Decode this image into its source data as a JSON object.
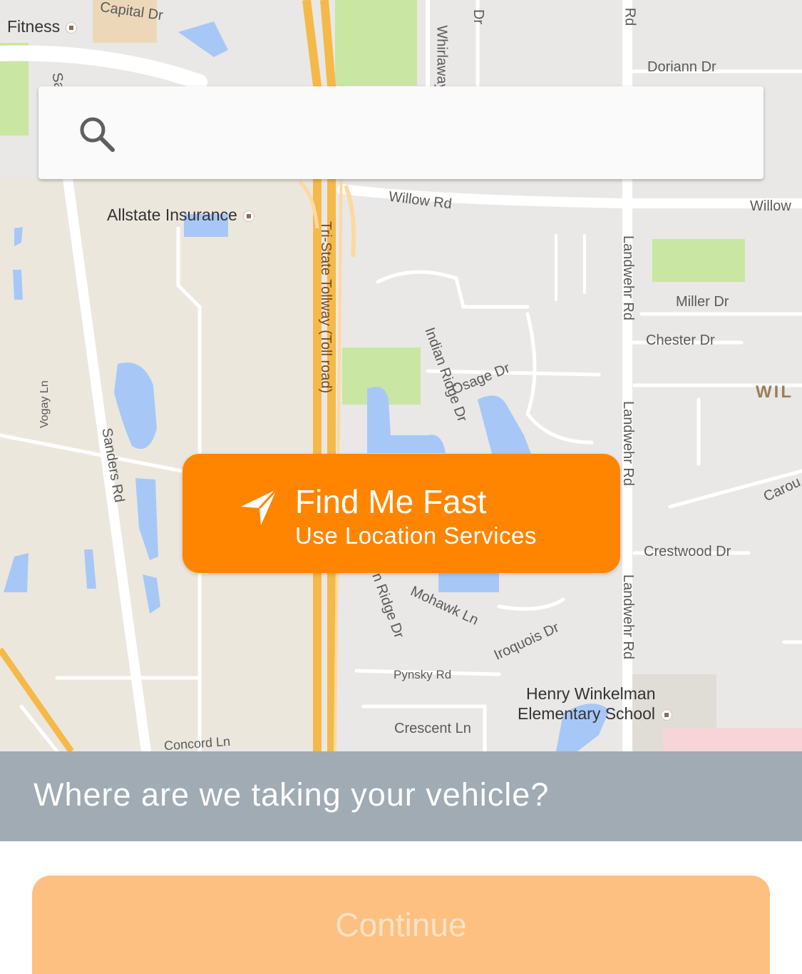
{
  "colors": {
    "accent": "#ff8400",
    "continue_disabled": "#fdc081",
    "prompt_bar": "#a0abb4",
    "map_bg": "#e9e8e6",
    "road": "#ffffff",
    "highway": "#f5b94a",
    "water": "#a7c8f7",
    "park": "#c9e6a3"
  },
  "map": {
    "labels": {
      "capital_dr": "Capital Dr",
      "fitness": "Fitness",
      "whirlaway": "Whirlaway",
      "dr_top": "Dr",
      "rd_top": "Rd",
      "doriann_dr": "Doriann Dr",
      "willow_rd": "Willow Rd",
      "willow_right": "Willow",
      "allstate": "Allstate Insurance",
      "tri_state": "Tri-State Tollway (Toll road)",
      "landwehr_1": "Landwehr Rd",
      "landwehr_2": "Landwehr Rd",
      "landwehr_3": "Landwehr Rd",
      "miller_dr": "Miller Dr",
      "chester_dr": "Chester Dr",
      "indian_ridge_dr": "Indian Ridge Dr",
      "osage_dr": "Osage Dr",
      "wil": "WIL",
      "vogay_ln": "Vogay Ln",
      "sanders_rd": "Sanders Rd",
      "sa": "Sa",
      "carou": "Carou",
      "crestwood_dr": "Crestwood Dr",
      "ridge_dr": "n Ridge Dr",
      "mohawk_ln": "Mohawk Ln",
      "iroquois_dr": "Iroquois Dr",
      "pynsky_rd": "Pynsky Rd",
      "henry_1": "Henry Winkelman",
      "henry_2": "Elementary School",
      "crescent_ln": "Crescent Ln",
      "concord_ln": "Concord Ln"
    }
  },
  "search": {
    "icon": "search-icon",
    "value": "",
    "placeholder": ""
  },
  "find_me": {
    "icon": "navigation-arrow-icon",
    "title": "Find Me Fast",
    "subtitle": "Use Location Services"
  },
  "prompt": {
    "text": "Where are we taking your vehicle?"
  },
  "continue_button": {
    "label": "Continue",
    "enabled": false
  }
}
